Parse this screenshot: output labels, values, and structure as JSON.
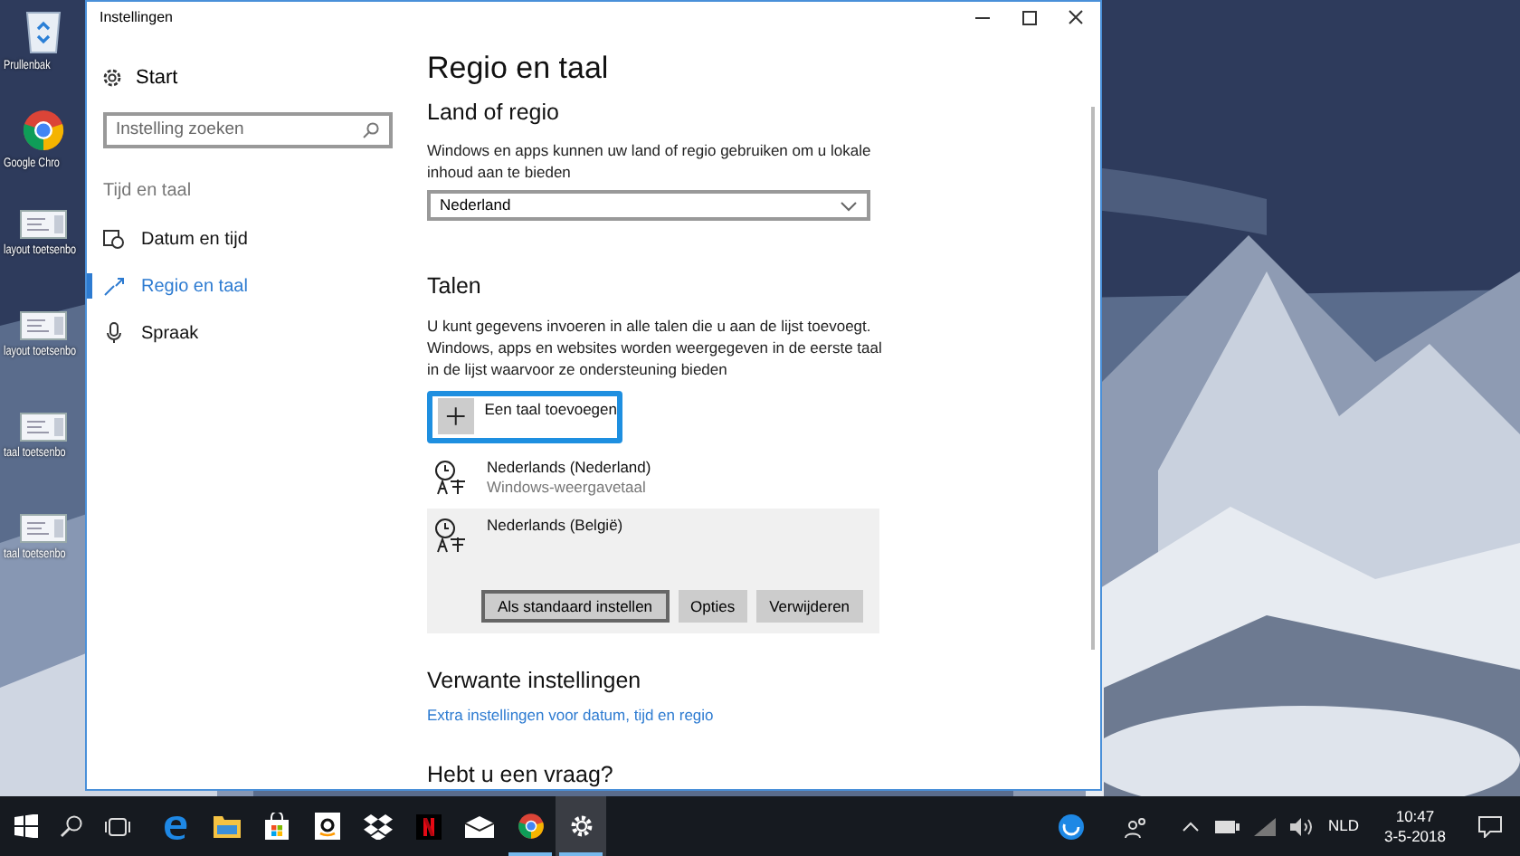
{
  "desktop_icons": [
    {
      "kind": "bin",
      "label": "Prullenbak"
    },
    {
      "kind": "chrome",
      "label": "Google Chro"
    },
    {
      "kind": "doc",
      "label": "layout toetsenbo"
    },
    {
      "kind": "doc",
      "label": "layout toetsenbo"
    },
    {
      "kind": "doc",
      "label": "taal toetsenbo"
    },
    {
      "kind": "doc",
      "label": "taal toetsenbo"
    }
  ],
  "window": {
    "title": "Instellingen"
  },
  "sidebar": {
    "home": "Start",
    "search": {
      "placeholder": "Instelling zoeken"
    },
    "group": "Tijd en taal",
    "items": [
      {
        "kind": "clock",
        "label": "Datum en tijd",
        "selected": false
      },
      {
        "kind": "region",
        "label": "Regio en taal",
        "selected": true
      },
      {
        "kind": "mic",
        "label": "Spraak",
        "selected": false
      }
    ]
  },
  "content": {
    "title": "Regio en taal",
    "region": {
      "heading": "Land of regio",
      "description": "Windows en apps kunnen uw land of regio gebruiken om u lokale inhoud aan te bieden",
      "value": "Nederland"
    },
    "languages": {
      "heading": "Talen",
      "description": "U kunt gegevens invoeren in alle talen die u aan de lijst toevoegt. Windows, apps en websites worden weergegeven in de eerste taal in de lijst waarvoor ze ondersteuning bieden",
      "add_button": "Een taal toevoegen",
      "highlighted": true,
      "items": [
        {
          "name": "Nederlands (Nederland)",
          "subtitle": "Windows-weergavetaal",
          "selected": false
        },
        {
          "name": "Nederlands (België)",
          "selected": true,
          "buttons": [
            "Als standaard instellen",
            "Opties",
            "Verwijderen"
          ]
        }
      ]
    },
    "related": {
      "heading": "Verwante instellingen",
      "link": "Extra instellingen voor datum, tijd en regio"
    },
    "question": {
      "heading": "Hebt u een vraag?"
    }
  },
  "taskbar": {
    "apps": [
      {
        "kind": "start",
        "running": false,
        "active": false
      },
      {
        "kind": "search",
        "running": false,
        "active": false
      },
      {
        "kind": "taskview",
        "running": false,
        "active": false
      },
      {
        "kind": "edge",
        "running": false,
        "active": false
      },
      {
        "kind": "explorer",
        "running": false,
        "active": false
      },
      {
        "kind": "store",
        "running": false,
        "active": false
      },
      {
        "kind": "amazon",
        "running": false,
        "active": false
      },
      {
        "kind": "dropbox",
        "running": false,
        "active": false
      },
      {
        "kind": "netflix",
        "running": false,
        "active": false
      },
      {
        "kind": "mail",
        "running": false,
        "active": false
      },
      {
        "kind": "chrome",
        "running": true,
        "active": false
      },
      {
        "kind": "settings",
        "running": true,
        "active": true
      }
    ],
    "language": "NLD",
    "time": "10:47",
    "date": "3-5-2018"
  }
}
